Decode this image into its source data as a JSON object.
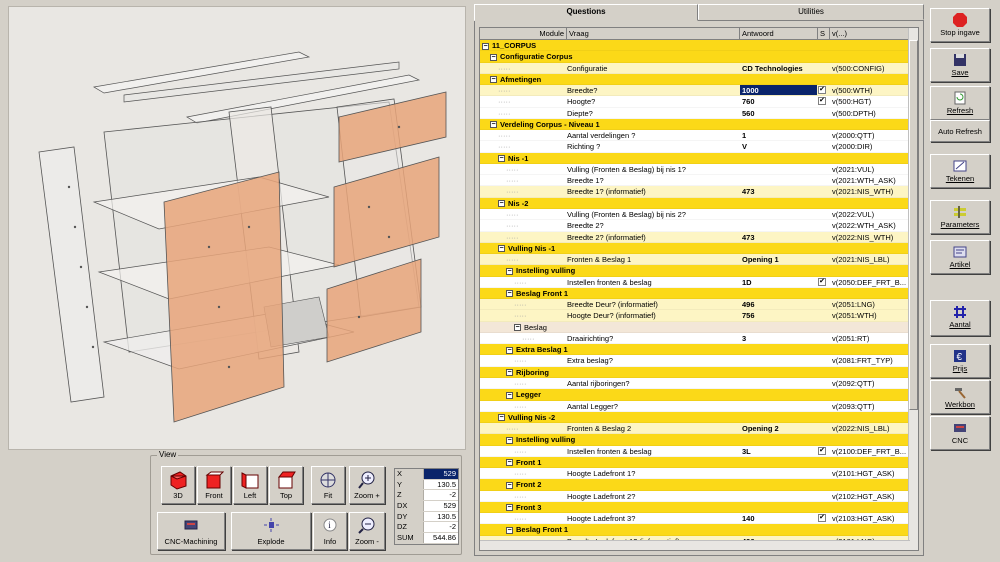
{
  "tabs": [
    {
      "label": "Questions"
    },
    {
      "label": "Utilities"
    }
  ],
  "grid": {
    "headers": {
      "module": "Module",
      "vraag": "Vraag",
      "antwoord": "Antwoord",
      "s": "S",
      "v": "v(...)"
    },
    "rows": [
      {
        "type": "g",
        "level": 0,
        "expander": "⊟",
        "name": "11_CORPUS",
        "q": "",
        "a": "",
        "s": false,
        "v": ""
      },
      {
        "type": "g",
        "level": 1,
        "expander": "⊟",
        "name": "Configuratie Corpus",
        "q": "",
        "a": "",
        "s": false,
        "v": ""
      },
      {
        "type": "p",
        "level": 2,
        "expander": "",
        "name": "",
        "q": "Configuratie",
        "a": "CD Technologies",
        "s": false,
        "v": "v(500:CONFIG)"
      },
      {
        "type": "g",
        "level": 1,
        "expander": "⊟",
        "name": "Afmetingen",
        "q": "",
        "a": "",
        "s": false,
        "v": ""
      },
      {
        "type": "p",
        "level": 2,
        "expander": "",
        "name": "",
        "q": "Breedte?",
        "a": "1000",
        "s": true,
        "v": "v(500:WTH)",
        "sel": true
      },
      {
        "type": "w",
        "level": 2,
        "expander": "",
        "name": "",
        "q": "Hoogte?",
        "a": "760",
        "s": true,
        "v": "v(500:HGT)"
      },
      {
        "type": "w",
        "level": 2,
        "expander": "",
        "name": "",
        "q": "Diepte?",
        "a": "560",
        "s": false,
        "v": "v(500:DPTH)"
      },
      {
        "type": "g",
        "level": 1,
        "expander": "⊟",
        "name": "Verdeling Corpus  - Niveau 1",
        "q": "",
        "a": "",
        "s": false,
        "v": ""
      },
      {
        "type": "w",
        "level": 2,
        "expander": "",
        "name": "",
        "q": "Aantal verdelingen ?",
        "a": "1",
        "s": false,
        "v": "v(2000:QTT)"
      },
      {
        "type": "w",
        "level": 2,
        "expander": "",
        "name": "",
        "q": "Richting ?",
        "a": "V",
        "s": false,
        "v": "v(2000:DIR)"
      },
      {
        "type": "g",
        "level": 2,
        "expander": "⊟",
        "name": "Nis -1",
        "q": "",
        "a": "",
        "s": false,
        "v": ""
      },
      {
        "type": "w",
        "level": 3,
        "expander": "",
        "name": "",
        "q": "Vulling (Fronten & Beslag) bij nis 1?",
        "a": "",
        "s": false,
        "v": "v(2021:VUL)"
      },
      {
        "type": "w",
        "level": 3,
        "expander": "",
        "name": "",
        "q": "Breedte 1?",
        "a": "",
        "s": false,
        "v": "v(2021:WTH_ASK)"
      },
      {
        "type": "p",
        "level": 3,
        "expander": "",
        "name": "",
        "q": "Breedte 1? (informatief)",
        "a": "473",
        "s": false,
        "v": "v(2021:NIS_WTH)"
      },
      {
        "type": "g",
        "level": 2,
        "expander": "⊟",
        "name": "Nis -2",
        "q": "",
        "a": "",
        "s": false,
        "v": ""
      },
      {
        "type": "w",
        "level": 3,
        "expander": "",
        "name": "",
        "q": "Vulling (Fronten & Beslag) bij nis 2?",
        "a": "",
        "s": false,
        "v": "v(2022:VUL)"
      },
      {
        "type": "w",
        "level": 3,
        "expander": "",
        "name": "",
        "q": "Breedte 2?",
        "a": "",
        "s": false,
        "v": "v(2022:WTH_ASK)"
      },
      {
        "type": "p",
        "level": 3,
        "expander": "",
        "name": "",
        "q": "Breedte 2? (informatief)",
        "a": "473",
        "s": false,
        "v": "v(2022:NIS_WTH)"
      },
      {
        "type": "g",
        "level": 2,
        "expander": "⊟",
        "name": "Vulling Nis -1",
        "q": "",
        "a": "",
        "s": false,
        "v": ""
      },
      {
        "type": "p",
        "level": 3,
        "expander": "",
        "name": "",
        "q": "Fronten & Beslag  1",
        "a": "Opening 1",
        "s": false,
        "v": "v(2021:NIS_LBL)"
      },
      {
        "type": "g",
        "level": 3,
        "expander": "⊟",
        "name": "Instelling vulling",
        "q": "",
        "a": "",
        "s": false,
        "v": ""
      },
      {
        "type": "w",
        "level": 4,
        "expander": "",
        "name": "",
        "q": "Instellen fronten & beslag",
        "a": "1D",
        "s": true,
        "v": "v(2050:DEF_FRT_B..."
      },
      {
        "type": "g",
        "level": 3,
        "expander": "⊟",
        "name": "Beslag Front 1",
        "q": "",
        "a": "",
        "s": false,
        "v": ""
      },
      {
        "type": "p",
        "level": 4,
        "expander": "",
        "name": "",
        "q": "Breedte Deur? (informatief)",
        "a": "496",
        "s": false,
        "v": "v(2051:LNG)"
      },
      {
        "type": "p",
        "level": 4,
        "expander": "",
        "name": "",
        "q": "Hoogte Deur? (informatief)",
        "a": "756",
        "s": false,
        "v": "v(2051:WTH)"
      },
      {
        "type": "b",
        "level": 4,
        "expander": "⊟",
        "name": "Beslag",
        "q": "",
        "a": "",
        "s": false,
        "v": ""
      },
      {
        "type": "w",
        "level": 5,
        "expander": "",
        "name": "",
        "q": "Draairichting?",
        "a": "3",
        "s": false,
        "v": "v(2051:RT)"
      },
      {
        "type": "g",
        "level": 3,
        "expander": "⊟",
        "name": "Extra Beslag 1",
        "q": "",
        "a": "",
        "s": false,
        "v": ""
      },
      {
        "type": "w",
        "level": 4,
        "expander": "",
        "name": "",
        "q": "Extra beslag?",
        "a": "",
        "s": false,
        "v": "v(2081:FRT_TYP)"
      },
      {
        "type": "g",
        "level": 3,
        "expander": "⊟",
        "name": "Rijboring",
        "q": "",
        "a": "",
        "s": false,
        "v": ""
      },
      {
        "type": "w",
        "level": 4,
        "expander": "",
        "name": "",
        "q": "Aantal rijboringen?",
        "a": "",
        "s": false,
        "v": "v(2092:QTT)"
      },
      {
        "type": "g",
        "level": 3,
        "expander": "⊟",
        "name": "Legger",
        "q": "",
        "a": "",
        "s": false,
        "v": ""
      },
      {
        "type": "w",
        "level": 4,
        "expander": "",
        "name": "",
        "q": "Aantal Legger?",
        "a": "",
        "s": false,
        "v": "v(2093:QTT)"
      },
      {
        "type": "g",
        "level": 2,
        "expander": "⊟",
        "name": "Vulling Nis -2",
        "q": "",
        "a": "",
        "s": false,
        "v": ""
      },
      {
        "type": "p",
        "level": 3,
        "expander": "",
        "name": "",
        "q": "Fronten & Beslag  2",
        "a": "Opening 2",
        "s": false,
        "v": "v(2022:NIS_LBL)"
      },
      {
        "type": "g",
        "level": 3,
        "expander": "⊟",
        "name": "Instelling vulling",
        "q": "",
        "a": "",
        "s": false,
        "v": ""
      },
      {
        "type": "w",
        "level": 4,
        "expander": "",
        "name": "",
        "q": "Instellen fronten & beslag",
        "a": "3L",
        "s": true,
        "v": "v(2100:DEF_FRT_B..."
      },
      {
        "type": "g",
        "level": 3,
        "expander": "⊟",
        "name": "Front 1",
        "q": "",
        "a": "",
        "s": false,
        "v": ""
      },
      {
        "type": "w",
        "level": 4,
        "expander": "",
        "name": "",
        "q": "Hoogte Ladefront 1?",
        "a": "",
        "s": false,
        "v": "v(2101:HGT_ASK)"
      },
      {
        "type": "g",
        "level": 3,
        "expander": "⊟",
        "name": "Front 2",
        "q": "",
        "a": "",
        "s": false,
        "v": ""
      },
      {
        "type": "w",
        "level": 4,
        "expander": "",
        "name": "",
        "q": "Hoogte Ladefront 2?",
        "a": "",
        "s": false,
        "v": "v(2102:HGT_ASK)"
      },
      {
        "type": "g",
        "level": 3,
        "expander": "⊟",
        "name": "Front 3",
        "q": "",
        "a": "",
        "s": false,
        "v": ""
      },
      {
        "type": "w",
        "level": 4,
        "expander": "",
        "name": "",
        "q": "Hoogte Ladefront 3?",
        "a": "140",
        "s": true,
        "v": "v(2103:HGT_ASK)"
      },
      {
        "type": "g",
        "level": 3,
        "expander": "⊟",
        "name": "Beslag Front 1",
        "q": "",
        "a": "",
        "s": false,
        "v": ""
      },
      {
        "type": "p",
        "level": 4,
        "expander": "",
        "name": "",
        "q": "Breedte Ladefront 1? (informatief)",
        "a": "496",
        "s": false,
        "v": "v(2101:LNG)"
      }
    ]
  },
  "view": {
    "group_label": "View",
    "buttons": {
      "b3d": "3D",
      "front": "Front",
      "left": "Left",
      "top": "Top",
      "fit": "Fit",
      "zoomin": "Zoom +",
      "cnc": "CNC-Machining",
      "explode": "Explode",
      "info": "Info",
      "zoomout": "Zoom -"
    },
    "coords": [
      {
        "k": "X",
        "v": "529"
      },
      {
        "k": "Y",
        "v": "130.5"
      },
      {
        "k": "Z",
        "v": "-2"
      },
      {
        "k": "DX",
        "v": "529"
      },
      {
        "k": "DY",
        "v": "130.5"
      },
      {
        "k": "DZ",
        "v": "-2"
      },
      {
        "k": "SUM",
        "v": "544.86"
      }
    ]
  },
  "sidebar": {
    "stop": "Stop ingave",
    "save": "Save",
    "refresh": "Refresh",
    "autorefresh": "Auto Refresh",
    "tekenen": "Tekenen",
    "parameters": "Parameters",
    "artikel": "Artikel",
    "aantal": "Aantal",
    "prijs": "Prijs",
    "werkbon": "Werkbon",
    "cnc": "CNC"
  },
  "colors": {
    "group": "#fbd918",
    "pale": "#fdf5c4",
    "panel": "#e8a070",
    "selection": "#0a246a"
  }
}
